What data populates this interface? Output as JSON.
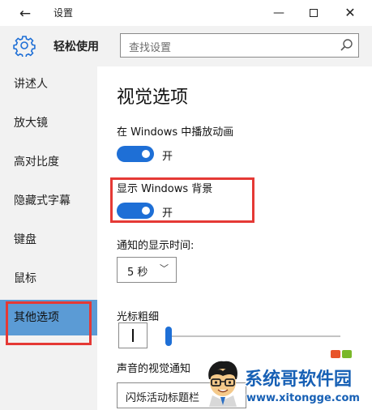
{
  "window": {
    "title": "设置",
    "back_glyph": "←",
    "min_glyph": "—",
    "close_glyph": "✕"
  },
  "header": {
    "section_title": "轻松使用",
    "section_icon": "gear-icon",
    "search_placeholder": "查找设置",
    "search_icon": "search-icon"
  },
  "sidebar": {
    "items": [
      {
        "label": "讲述人"
      },
      {
        "label": "放大镜"
      },
      {
        "label": "高对比度"
      },
      {
        "label": "隐藏式字幕"
      },
      {
        "label": "键盘"
      },
      {
        "label": "鼠标"
      },
      {
        "label": "其他选项"
      }
    ],
    "selected": "其他选项",
    "selected_color": "#5b9bd5"
  },
  "main": {
    "title": "视觉选项",
    "animation": {
      "label": "在 Windows 中播放动画",
      "state": "开"
    },
    "background": {
      "label": "显示 Windows 背景",
      "state": "开"
    },
    "notification_time": {
      "label": "通知的显示时间:",
      "value": "5 秒",
      "chevron": "﹀"
    },
    "cursor_thickness": {
      "label": "光标粗细",
      "slider_fraction": 0.0
    },
    "visual_notification": {
      "label": "声音的视觉通知",
      "value": "闪烁活动标题栏"
    }
  },
  "watermark": {
    "name": "系统哥软件园",
    "url": "www.xitongge.com"
  },
  "colors": {
    "accent": "#1e6fd6",
    "highlight_border": "#e53935",
    "sidebar_bg": "#f2f2f2",
    "watermark_text": "#1760b5"
  }
}
